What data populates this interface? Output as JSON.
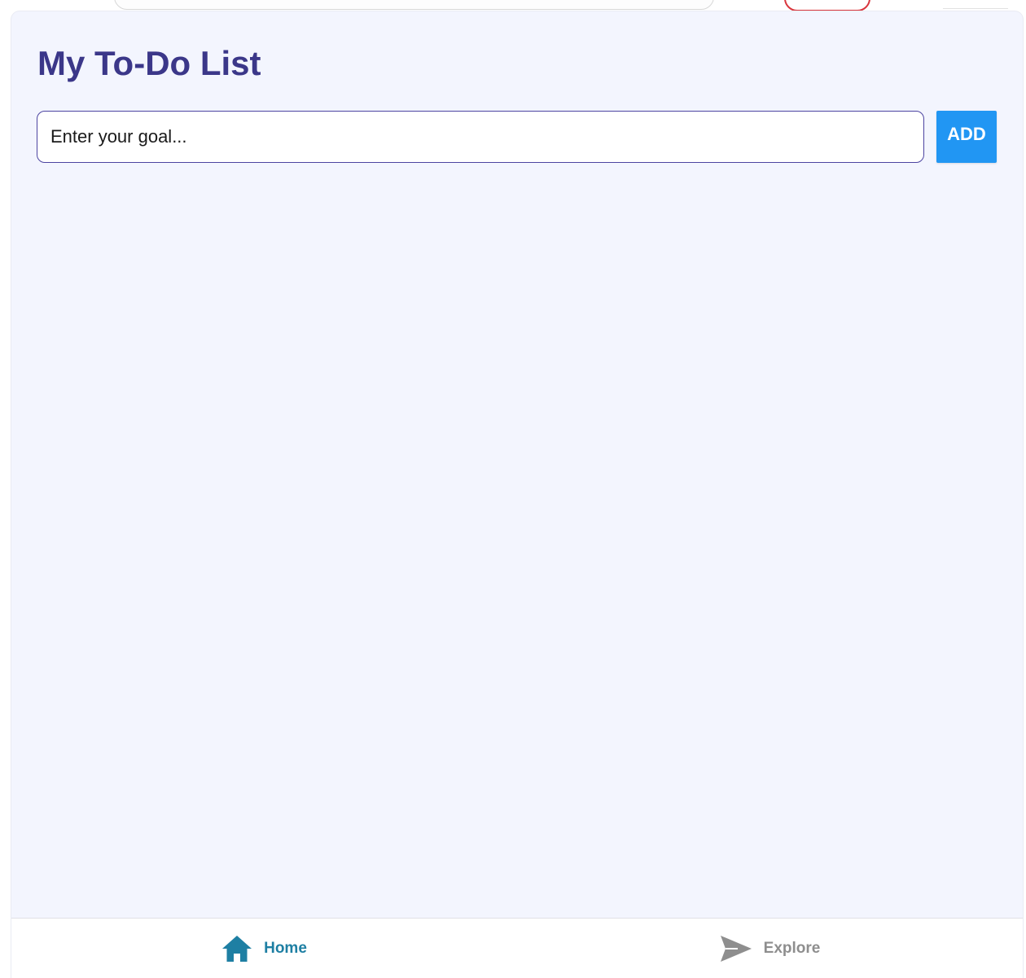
{
  "app": {
    "title": "My To-Do List"
  },
  "goal_form": {
    "input_value": "",
    "input_placeholder": "Enter your goal...",
    "add_label": "ADD"
  },
  "tasks": [],
  "bottom_nav": {
    "items": [
      {
        "label": "Home",
        "icon": "home-icon",
        "active": true
      },
      {
        "label": "Explore",
        "icon": "send-icon",
        "active": false
      }
    ]
  },
  "colors": {
    "title": "#3b3789",
    "input_border": "#4c44a1",
    "add_button": "#2196f3",
    "background": "#f3f5fe",
    "nav_active": "#1e7fa3",
    "nav_inactive": "#8e8e8e"
  }
}
